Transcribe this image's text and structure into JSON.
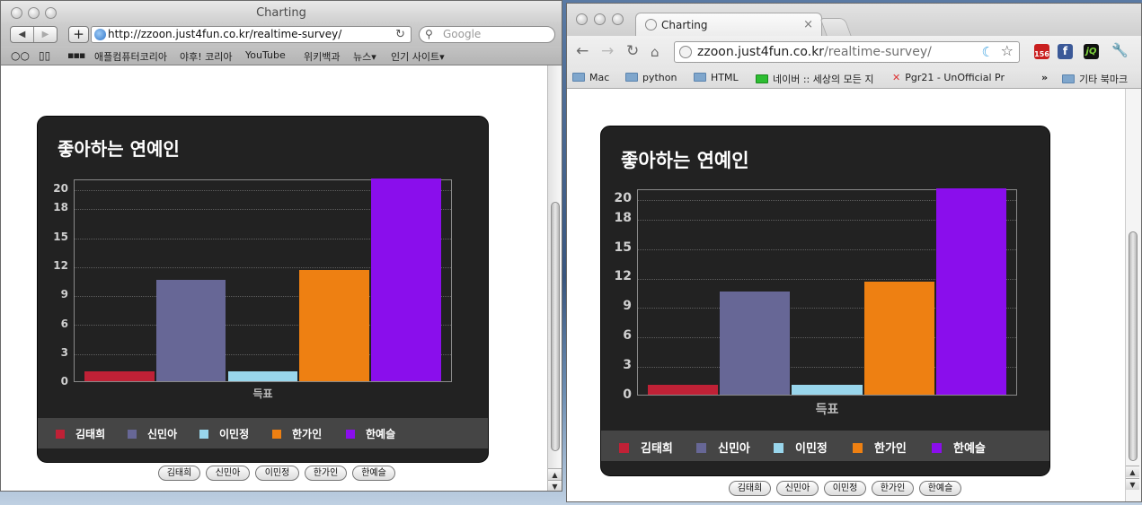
{
  "left_window": {
    "title": "Charting",
    "url": "http://zzoon.just4fun.co.kr/realtime-survey/",
    "search_placeholder": "Google",
    "nav_back": "◀",
    "nav_forward": "▶",
    "add_label": "+",
    "reload_glyph": "↻",
    "bookmarks": [
      "애플컴퓨터코리아",
      "야후! 코리아",
      "YouTube",
      "위키백과",
      "뉴스▾",
      "인기 사이트▾"
    ]
  },
  "right_window": {
    "tab_title": "Charting",
    "tab_close": "×",
    "url_host": "zzoon.just4fun.co.kr",
    "url_path": "/realtime-survey/",
    "extension_badge": "156",
    "bookmarks": [
      "Mac",
      "python",
      "HTML",
      "네이버 :: 세상의 모든 지",
      "Pgr21 - UnOfficial Pr",
      "»",
      "기타 북마크"
    ]
  },
  "chart_data": {
    "type": "bar",
    "title": "좋아하는 연예인",
    "xlabel": "득표",
    "categories": [
      "득표"
    ],
    "series": [
      {
        "name": "김태희",
        "value": 1,
        "color": "#c02136"
      },
      {
        "name": "신민아",
        "value": 10.5,
        "color": "#676796"
      },
      {
        "name": "이민정",
        "value": 1,
        "color": "#99d6ec"
      },
      {
        "name": "한가인",
        "value": 11.5,
        "color": "#ee8012"
      },
      {
        "name": "한예슬",
        "value": 21,
        "color": "#8a0eec"
      }
    ],
    "yticks": [
      "0",
      "3",
      "6",
      "9",
      "12",
      "15",
      "18",
      "20"
    ],
    "ylim": [
      0,
      21
    ],
    "grid": true,
    "legend_position": "bottom"
  },
  "buttons": [
    "김태희",
    "신민아",
    "이민정",
    "한가인",
    "한예슬"
  ]
}
